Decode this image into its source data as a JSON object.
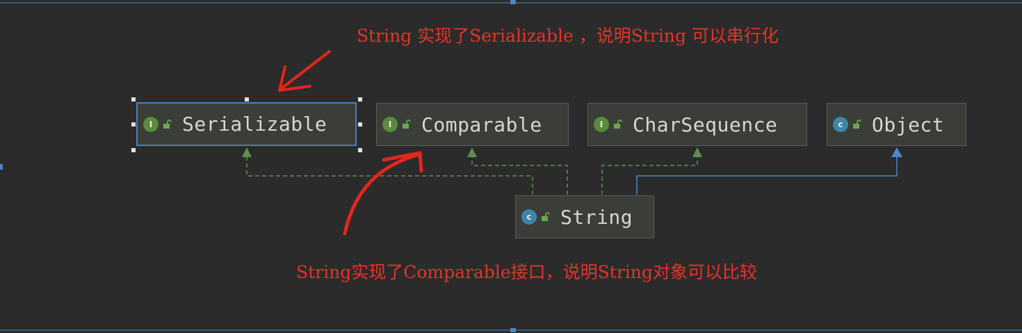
{
  "nodes": {
    "serializable": {
      "kind": "interface",
      "badge": "I",
      "label": "Serializable"
    },
    "comparable": {
      "kind": "interface",
      "badge": "I",
      "label": "Comparable"
    },
    "charsequence": {
      "kind": "interface",
      "badge": "I",
      "label": "CharSequence"
    },
    "object": {
      "kind": "class",
      "badge": "c",
      "label": "Object"
    },
    "string": {
      "kind": "class",
      "badge": "c",
      "label": "String"
    }
  },
  "edges": [
    {
      "from": "string",
      "to": "serializable",
      "relation": "implements"
    },
    {
      "from": "string",
      "to": "comparable",
      "relation": "implements"
    },
    {
      "from": "string",
      "to": "charsequence",
      "relation": "implements"
    },
    {
      "from": "string",
      "to": "object",
      "relation": "extends"
    }
  ],
  "annotations": {
    "top": "String 实现了Serializable ，说明String 可以串行化",
    "bottom": "String实现了Comparable接口，说明String对象可以比较"
  },
  "colors": {
    "background": "#2b2b2b",
    "node_fill": "#3b3e38",
    "implements_line": "#5f8f4e",
    "extends_line": "#4a88d0",
    "annotation": "#e8322a",
    "selection_border": "#4a80c0"
  }
}
